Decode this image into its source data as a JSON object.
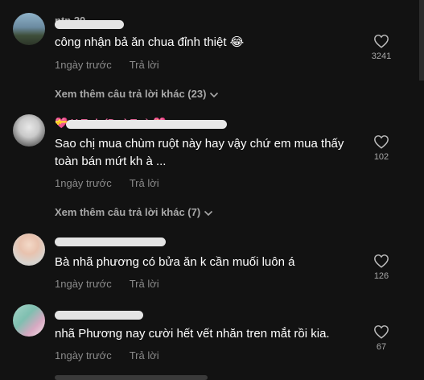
{
  "comments": [
    {
      "text": "công nhận bả ăn chua đỉnh thiệt 😂",
      "time": "1ngày trước",
      "reply_label": "Trả lời",
      "likes": "3241",
      "more_replies": "Xem thêm câu trả lời khác (23)"
    },
    {
      "text": "Sao chị mua chùm ruột này hay vậy chứ em mua thấy toàn bán mứt kh à ...",
      "time": "1ngày trước",
      "reply_label": "Trả lời",
      "likes": "102",
      "more_replies": "Xem thêm câu trả lời khác (7)"
    },
    {
      "text": "Bà nhã phương có bửa ăn k cần muối luôn á",
      "time": "1ngày trước",
      "reply_label": "Trả lời",
      "likes": "126"
    },
    {
      "text": "nhã Phương nay cười hết vết nhăn tren mắt rồi kia.",
      "time": "1ngày trước",
      "reply_label": "Trả lời",
      "likes": "67"
    }
  ],
  "colors": {
    "background": "#121212",
    "secondary_text": "#8a8a8a",
    "heart_outline": "#bdbdbd"
  }
}
